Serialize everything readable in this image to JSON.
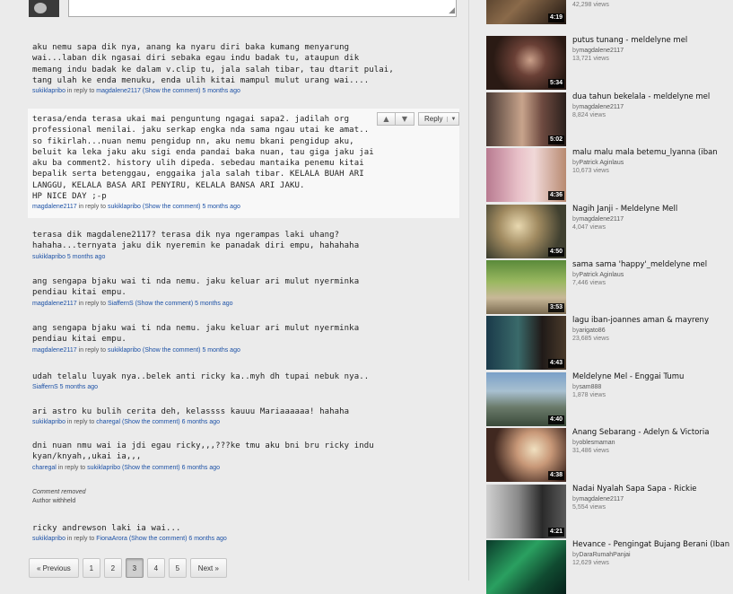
{
  "comments": [
    {
      "text": "aku nemu sapa dik nya, anang ka nyaru diri baka kumang menyarung\nwai...laban dik ngasai diri sebaka egau indu badak tu, ataupun dik\nmemang indu badak ke dalam v.clip tu, jala salah tibar, tau dtarit pulai,\ntang ulah ke enda menuku, enda ulih kitai mampul mulut urang wai....",
      "author": "sukiklapribo",
      "in_reply": "in reply to",
      "reply_to": "magdalene2117",
      "show": "(Show the comment)",
      "ago": "5 months ago"
    },
    {
      "text": "terasa/enda terasa ukai mai penguntung ngagai sapa2. jadilah org\nprofessional menilai. jaku serkap engka nda sama ngau utai ke amat..\nso fikirlah...nuan nemu pengidup nn, aku nemu bkani pengidup aku,\nbeluit ka leka jaku aku sigi enda pandai baka nuan, tau giga jaku jai\naku ba comment2. history ulih dipeda. sebedau mantaika penemu kitai\nbepalik serta betenggau, enggaika jala salah tibar. KELALA BUAH ARI\nLANGGU, KELALA BASA ARI PENYIRU, KELALA BANSA ARI JAKU.\nHP NICE DAY ;-p",
      "author": "magdalene2117",
      "in_reply": "in reply to",
      "reply_to": "sukiklapribo",
      "show": "(Show the comment)",
      "ago": "5 months ago"
    },
    {
      "text": "terasa dik magdalene2117? terasa dik nya ngerampas laki uhang?\nhahaha...ternyata jaku dik nyeremin ke panadak diri empu, hahahaha",
      "author": "sukiklapribo",
      "ago": "5 months ago"
    },
    {
      "text": "ang sengapa bjaku wai ti nda nemu. jaku keluar ari mulut nyerminka\npendiau kitai empu.",
      "author": "magdalene2117",
      "in_reply": "in reply to",
      "reply_to": "SiaffernS",
      "show": "(Show the comment)",
      "ago": "5 months ago"
    },
    {
      "text": "ang sengapa bjaku wai ti nda nemu. jaku keluar ari mulut nyerminka\npendiau kitai empu.",
      "author": "magdalene2117",
      "in_reply": "in reply to",
      "reply_to": "sukiklapribo",
      "show": "(Show the comment)",
      "ago": "5 months ago"
    },
    {
      "text": "udah telalu luyak nya..belek anti ricky ka..myh dh tupai nebuk nya..",
      "author": "SiaffernS",
      "ago": "5 months ago"
    },
    {
      "text": "ari astro ku bulih cerita deh, kelassss kauuu Mariaaaaaa! hahaha",
      "author": "sukiklapribo",
      "in_reply": "in reply to",
      "reply_to": "charegal",
      "show": "(Show the comment)",
      "ago": "6 months ago"
    },
    {
      "text": "dni nuan nmu wai ia jdi egau ricky,,,???ke tmu aku bni bru ricky indu\nkyan/knyah,,ukai ia,,,",
      "author": "charegal",
      "in_reply": "in reply to",
      "reply_to": "sukiklapribo",
      "show": "(Show the comment)",
      "ago": "6 months ago"
    },
    {
      "text": "ricky andrewson laki ia wai...",
      "author": "sukiklapribo",
      "in_reply": "in reply to",
      "reply_to": "FionaArora",
      "show": "(Show the comment)",
      "ago": "6 months ago"
    }
  ],
  "removed": {
    "title": "Comment removed",
    "by": "Author withheld"
  },
  "reply_button": {
    "label": "Reply"
  },
  "pagination": {
    "prev": "« Previous",
    "pages": [
      "1",
      "2",
      "3",
      "4",
      "5"
    ],
    "current": "3",
    "next": "Next »"
  },
  "videos": [
    {
      "title": "",
      "uploader": "",
      "views": "42,298 views",
      "duration": "4:19"
    },
    {
      "title": "putus tunang - meldelyne mel",
      "by": "by",
      "uploader": "magdalene2117",
      "views": "13,721 views",
      "duration": "5:34"
    },
    {
      "title": "dua tahun bekelala - meldelyne mel",
      "by": "by",
      "uploader": "magdalene2117",
      "views": "8,824 views",
      "duration": "5:02"
    },
    {
      "title": "malu malu mala betemu_lyanna (iban",
      "by": "by",
      "uploader": "Patrick Aginlaus",
      "views": "10,673 views",
      "duration": "4:36"
    },
    {
      "title": "Nagih Janji - Meldelyne Mell",
      "by": "by",
      "uploader": "magdalene2117",
      "views": "4,047 views",
      "duration": "4:50"
    },
    {
      "title": "sama sama 'happy'_meldelyne mel",
      "by": "by",
      "uploader": "Patrick Aginlaus",
      "views": "7,446 views",
      "duration": "3:53"
    },
    {
      "title": "lagu iban-joannes aman & mayreny",
      "by": "by",
      "uploader": "arigato86",
      "views": "23,685 views",
      "duration": "4:43"
    },
    {
      "title": "Meldelyne Mel - Enggai Tumu",
      "by": "by",
      "uploader": "sam888",
      "views": "1,878 views",
      "duration": "4:40"
    },
    {
      "title": "Anang Sebarang - Adelyn & Victoria",
      "by": "by",
      "uploader": "oblesmaman",
      "views": "31,486 views",
      "duration": "4:38"
    },
    {
      "title": "Nadai Nyalah Sapa Sapa - Rickie",
      "by": "by",
      "uploader": "magdalene2117",
      "views": "5,554 views",
      "duration": "4:21"
    },
    {
      "title": "Hevance - Pengingat Bujang Berani (Iban",
      "by": "by",
      "uploader": "DaraRumahPanjai",
      "views": "12,629 views",
      "duration": ""
    }
  ],
  "colors": {
    "link": "#1c51a6",
    "page_bg": "#ebebeb",
    "highlight_bg": "#f8f8f8"
  }
}
